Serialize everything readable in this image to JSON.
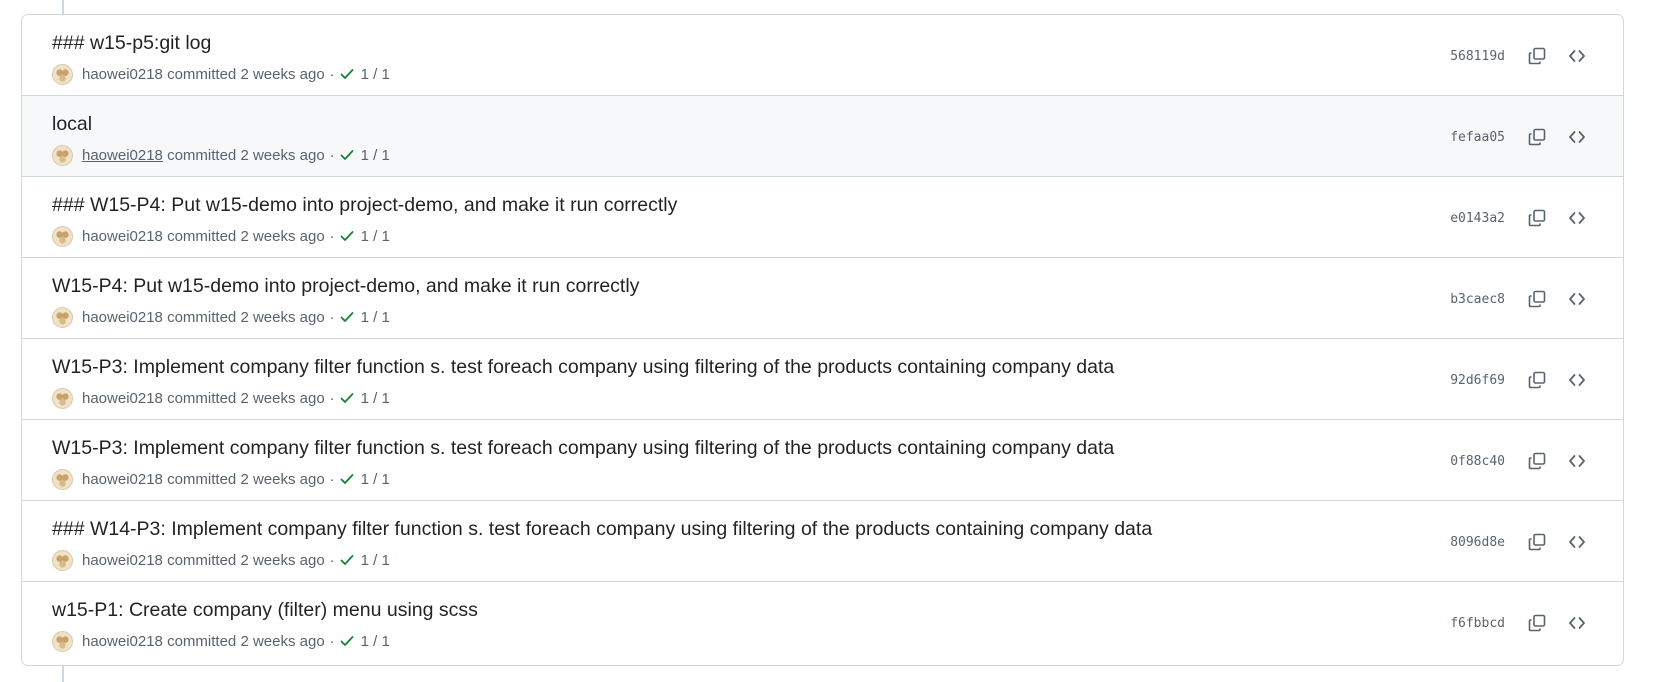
{
  "colors": {
    "border": "#d0d7de",
    "hover_row_bg": "#f6f8fa",
    "muted_text": "#59636e",
    "success_green": "#1a7f37"
  },
  "icons": {
    "check": "check-icon",
    "copy": "copy-icon",
    "browse": "code-icon"
  },
  "commits": [
    {
      "message": "### w15-p5:git log",
      "author": "haowei0218",
      "verb": "committed",
      "time": "2 weeks ago",
      "separator": "·",
      "checks": "1 / 1",
      "sha": "568119d"
    },
    {
      "message": "local",
      "author": "haowei0218",
      "verb": "committed",
      "time": "2 weeks ago",
      "separator": "·",
      "checks": "1 / 1",
      "sha": "fefaa05"
    },
    {
      "message": "### W15-P4: Put w15-demo into project-demo, and make it run correctly",
      "author": "haowei0218",
      "verb": "committed",
      "time": "2 weeks ago",
      "separator": "·",
      "checks": "1 / 1",
      "sha": "e0143a2"
    },
    {
      "message": "W15-P4: Put w15-demo into project-demo, and make it run correctly",
      "author": "haowei0218",
      "verb": "committed",
      "time": "2 weeks ago",
      "separator": "·",
      "checks": "1 / 1",
      "sha": "b3caec8"
    },
    {
      "message": "W15-P3: Implement company filter function s. test foreach company using filtering of the products containing company data",
      "author": "haowei0218",
      "verb": "committed",
      "time": "2 weeks ago",
      "separator": "·",
      "checks": "1 / 1",
      "sha": "92d6f69"
    },
    {
      "message": "W15-P3: Implement company filter function s. test foreach company using filtering of the products containing company data",
      "author": "haowei0218",
      "verb": "committed",
      "time": "2 weeks ago",
      "separator": "·",
      "checks": "1 / 1",
      "sha": "0f88c40"
    },
    {
      "message": "### W14-P3: Implement company filter function s. test foreach company using filtering of the products containing company data",
      "author": "haowei0218",
      "verb": "committed",
      "time": "2 weeks ago",
      "separator": "·",
      "checks": "1 / 1",
      "sha": "8096d8e"
    },
    {
      "message": "w15-P1: Create company (filter) menu using scss",
      "author": "haowei0218",
      "verb": "committed",
      "time": "2 weeks ago",
      "separator": "·",
      "checks": "1 / 1",
      "sha": "f6fbbcd"
    }
  ]
}
